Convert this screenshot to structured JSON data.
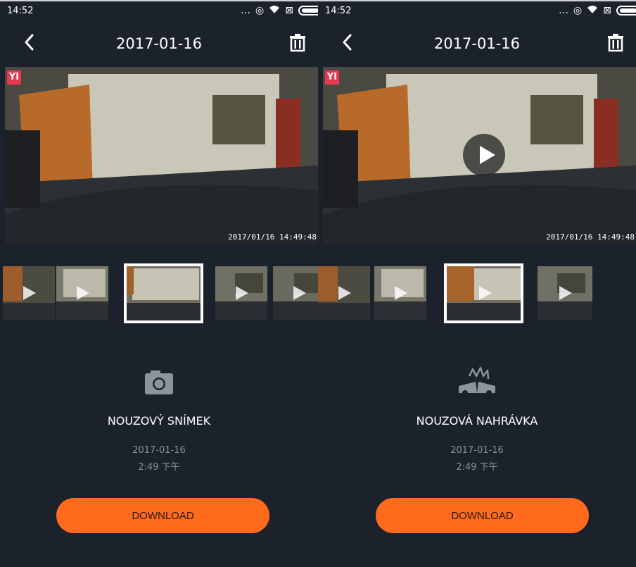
{
  "left": {
    "status": {
      "time": "14:52"
    },
    "header": {
      "title": "2017-01-16"
    },
    "preview": {
      "logo": "YI",
      "timestamp": "2017/01/16 14:49:48",
      "has_play_overlay": false
    },
    "detail": {
      "icon": "camera-icon",
      "label": "NOUZOVÝ SNÍMEK",
      "date": "2017-01-16",
      "time": "2:49 下午"
    },
    "download_label": "DOWNLOAD"
  },
  "right": {
    "status": {
      "time": "14:52"
    },
    "header": {
      "title": "2017-01-16"
    },
    "preview": {
      "logo": "YI",
      "timestamp": "2017/01/16 14:49:48",
      "has_play_overlay": true
    },
    "detail": {
      "icon": "car-collision-icon",
      "label": "NOUZOVÁ NAHRÁVKA",
      "date": "2017-01-16",
      "time": "2:49 下午"
    },
    "download_label": "DOWNLOAD"
  },
  "colors": {
    "background": "#1b222c",
    "accent": "#ff6a1c",
    "muted_text": "#8b929b",
    "logo": "#e8384f"
  }
}
